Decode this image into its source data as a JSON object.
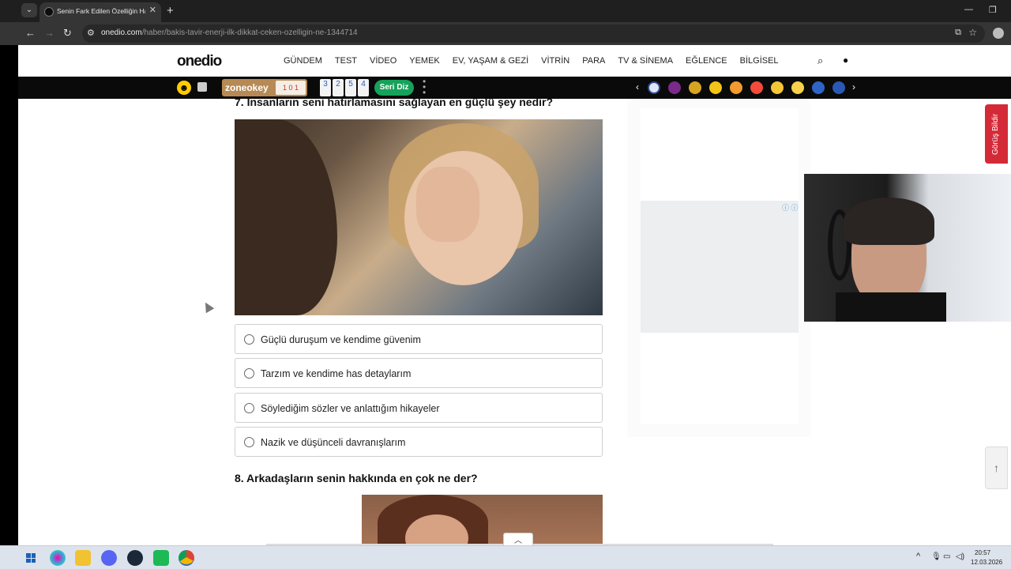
{
  "browser": {
    "tab_title": "Senin Fark Edilen Özelliğin Han",
    "url_host": "onedio.com",
    "url_path": "/haber/bakis-tavir-enerji-ilk-dikkat-ceken-ozelligin-ne-1344714"
  },
  "site": {
    "logo": "onedio",
    "nav": [
      "GÜNDEM",
      "TEST",
      "VİDEO",
      "YEMEK",
      "EV, YAŞAM & GEZİ",
      "VİTRİN",
      "PARA",
      "TV & SİNEMA",
      "EĞLENCE",
      "BİLGİSEL"
    ]
  },
  "game_bar": {
    "brand": "zoneokey",
    "tiles": [
      "3",
      "2",
      "5",
      "4"
    ],
    "seri_diz": "Seri Diz"
  },
  "quiz": {
    "q7_title": "7. İnsanların seni hatırlamasını sağlayan en güçlü şey nedir?",
    "q7_options": [
      "Güçlü duruşum ve kendime güvenim",
      "Tarzım ve kendime has detaylarım",
      "Söylediğim sözler ve anlattığım hikayeler",
      "Nazik ve düşünceli davranışlarım"
    ],
    "q8_title": "8. Arkadaşların senin hakkında en çok ne der?"
  },
  "feedback_tab": "Görüş Bildir",
  "taskbar": {
    "time": "20:57",
    "date": "12.03.2026"
  },
  "colors": {
    "feedback_red": "#d42a37",
    "seri_diz_green": "#16a25a"
  }
}
